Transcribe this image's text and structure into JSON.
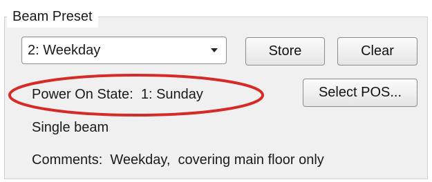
{
  "group": {
    "title": "Beam Preset"
  },
  "preset_select": {
    "value": "2: Weekday"
  },
  "buttons": {
    "store": "Store",
    "clear": "Clear",
    "select_pos": "Select POS..."
  },
  "power_on_state": "Power On State:  1: Sunday",
  "beam_mode": "Single beam",
  "comments": "Comments:  Weekday,  covering main floor only",
  "annotation_color": "#d62a26"
}
